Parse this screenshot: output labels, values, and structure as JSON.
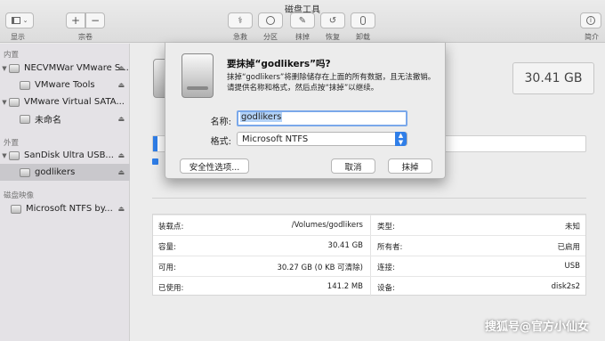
{
  "window": {
    "title": "磁盘工具"
  },
  "toolbar": {
    "view_label": "显示",
    "volume_label": "宗卷",
    "firstaid_label": "急救",
    "partition_label": "分区",
    "erase_label": "抹掉",
    "restore_label": "恢复",
    "unmount_label": "卸载",
    "info_label": "简介",
    "add_symbol": "+",
    "remove_symbol": "−"
  },
  "sidebar": {
    "sections": [
      "内置",
      "外置",
      "磁盘映像"
    ],
    "items": [
      {
        "label": "NECVMWar VMware S...",
        "eject": "⏏"
      },
      {
        "label": "VMware Tools",
        "eject": "⏏"
      },
      {
        "label": "VMware Virtual SATA...",
        "eject": ""
      },
      {
        "label": "未命名",
        "eject": "⏏"
      },
      {
        "label": "SanDisk Ultra USB...",
        "eject": "⏏"
      },
      {
        "label": "godlikers",
        "eject": "⏏"
      },
      {
        "label": "Microsoft NTFS by...",
        "eject": "⏏"
      }
    ]
  },
  "main": {
    "capacity_badge": "30.41 GB",
    "usage_fraction": 0.01,
    "info": {
      "left": [
        {
          "label": "装载点:",
          "value": "/Volumes/godlikers"
        },
        {
          "label": "容量:",
          "value": "30.41 GB"
        },
        {
          "label": "可用:",
          "value": "30.27 GB (0 KB 可清除)"
        },
        {
          "label": "已使用:",
          "value": "141.2 MB"
        }
      ],
      "right": [
        {
          "label": "类型:",
          "value": "未知"
        },
        {
          "label": "所有者:",
          "value": "已启用"
        },
        {
          "label": "连接:",
          "value": "USB"
        },
        {
          "label": "设备:",
          "value": "disk2s2"
        }
      ]
    }
  },
  "dialog": {
    "title": "要抹掉“godlikers”吗?",
    "message": "抹掉“godlikers”将删除储存在上面的所有数据，且无法撤销。请提供名称和格式，然后点按“抹掉”以继续。",
    "name_label": "名称:",
    "name_value": "godlikers",
    "format_label": "格式:",
    "format_value": "Microsoft NTFS",
    "security_button": "安全性选项...",
    "cancel_button": "取消",
    "erase_button": "抹掉"
  },
  "watermark": "搜狐号@官方小仙女"
}
